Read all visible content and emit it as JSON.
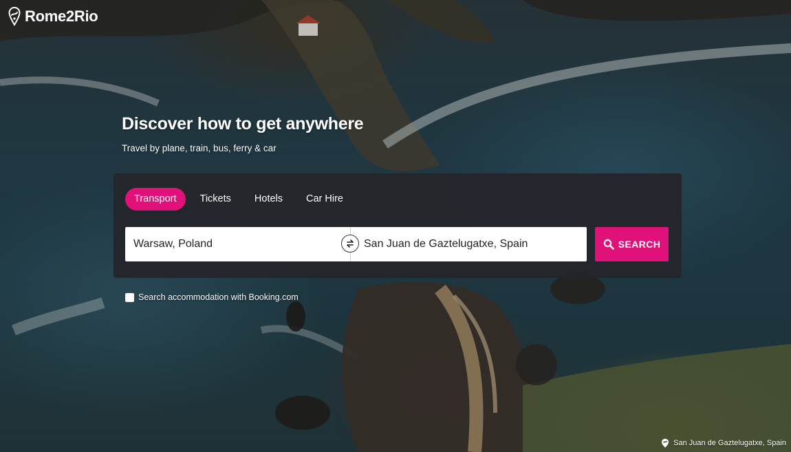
{
  "brand": {
    "name": "Rome2Rio",
    "logo_icon": "rome2rio-pin-logo"
  },
  "hero": {
    "title": "Discover how to get anywhere",
    "subtitle": "Travel by plane, train, bus, ferry & car"
  },
  "tabs": [
    {
      "label": "Transport",
      "active": true
    },
    {
      "label": "Tickets",
      "active": false
    },
    {
      "label": "Hotels",
      "active": false
    },
    {
      "label": "Car Hire",
      "active": false
    }
  ],
  "search": {
    "origin_value": "Warsaw, Poland",
    "destination_value": "San Juan de Gaztelugatxe, Spain",
    "swap_icon": "swap-arrows-icon",
    "button_label": "SEARCH",
    "button_icon": "search-icon"
  },
  "accommodation": {
    "label": "Search accommodation with Booking.com",
    "checked": false
  },
  "photo_credit": {
    "location": "San Juan de Gaztelugatxe, Spain",
    "icon": "location-pin-icon"
  },
  "colors": {
    "accent": "#e0127a",
    "panel": "#24252a"
  }
}
